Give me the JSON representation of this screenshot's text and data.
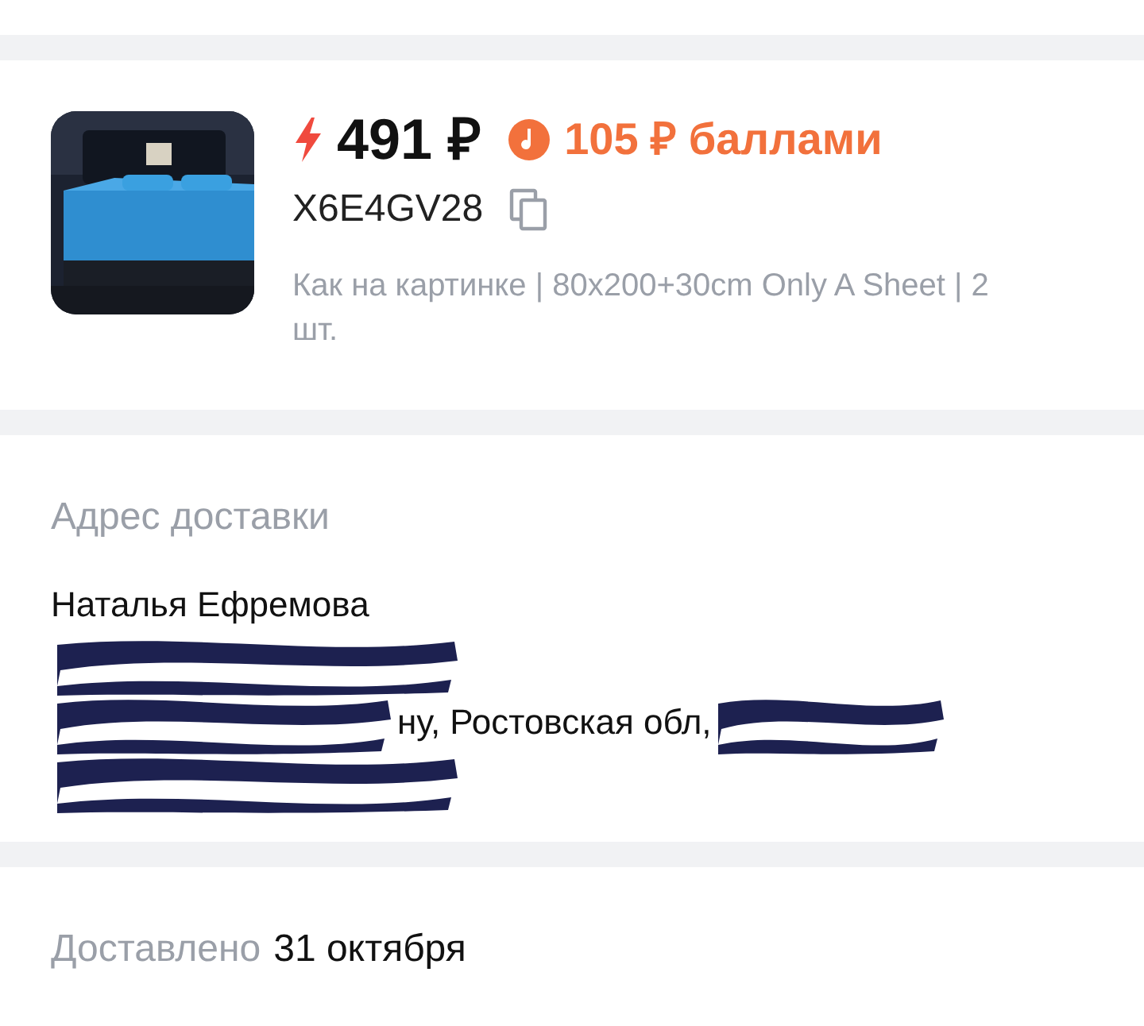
{
  "product": {
    "price": "491 ₽",
    "bonus": "105 ₽ баллами",
    "code": "X6E4GV28",
    "description": "Как на картинке | 80x200+30cm Only A Sheet | 2 шт."
  },
  "address": {
    "title": "Адрес доставки",
    "lines": [
      {
        "kind": "text",
        "text": "Наталья Ефремова"
      },
      {
        "kind": "redacted"
      },
      {
        "kind": "partial",
        "text": "ну, Ростовская обл,"
      },
      {
        "kind": "redacted"
      }
    ]
  },
  "delivery": {
    "label": "Доставлено",
    "date": "31 октября"
  }
}
